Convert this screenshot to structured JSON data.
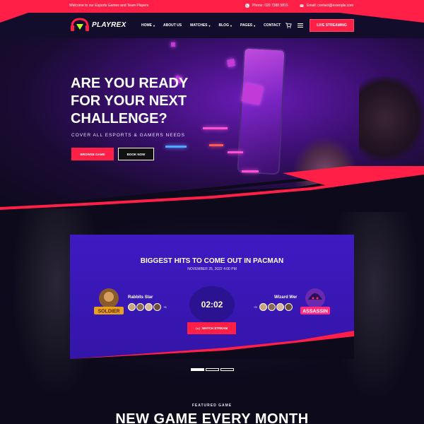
{
  "topbar": {
    "welcome": "Welcome to our Esports Games and Team Players",
    "phone": "Phone: 020 7388 5815",
    "email": "Email: contact@example.com"
  },
  "brand": {
    "name": "PLAYREX"
  },
  "nav": {
    "items": [
      {
        "label": "HOME",
        "has_dropdown": true
      },
      {
        "label": "ABOUT US",
        "has_dropdown": false
      },
      {
        "label": "MATCHES",
        "has_dropdown": true
      },
      {
        "label": "BLOG",
        "has_dropdown": true
      },
      {
        "label": "PAGES",
        "has_dropdown": true
      },
      {
        "label": "CONTACT",
        "has_dropdown": false
      }
    ],
    "live_button": "LIVE STREAMING"
  },
  "hero": {
    "title": "ARE YOU READY FOR YOUR NEXT CHALLENGE?",
    "subtitle": "COVER ALL ESPORTS & GAMERS NEEDS",
    "browse_button": "BROWSE GAME",
    "book_button": "BOOK NOW"
  },
  "match": {
    "title": "BIGGEST HITS TO COME OUT IN PACMAN",
    "date": "NOVEMBER 25, 2022 4:00 PM",
    "team_left": {
      "name": "Rabbits Star",
      "logo_text": "SOLDIER",
      "extra": "+5"
    },
    "team_right": {
      "name": "Wizard Wer",
      "logo_text": "ASSASSIN",
      "extra": "+5"
    },
    "timer": "02:02",
    "watch_button": "WATCH STREAM"
  },
  "featured": {
    "label": "FEATURED GAME",
    "title": "NEW GAME EVERY MONTH"
  },
  "colors": {
    "accent": "#ff1f47",
    "header_bg": "#120d2a",
    "card_bg": "#3a17b8",
    "page_bg": "#0d0a1c"
  }
}
